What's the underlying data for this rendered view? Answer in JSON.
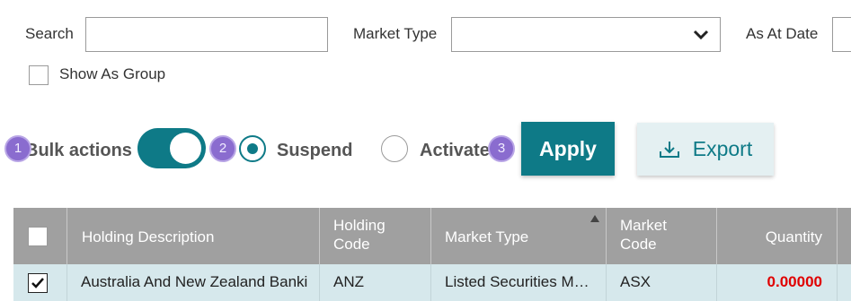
{
  "filters": {
    "search_label": "Search",
    "search_value": "",
    "market_type_label": "Market Type",
    "market_type_value": "",
    "as_at_date_label": "As At Date",
    "show_as_group_label": "Show As Group"
  },
  "bulk": {
    "label": "Bulk actions",
    "suspend_label": "Suspend",
    "activate_label": "Activate",
    "apply_label": "Apply",
    "export_label": "Export",
    "steps": [
      "1",
      "2",
      "3"
    ]
  },
  "table": {
    "columns": [
      "Holding Description",
      "Holding Code",
      "Market Type",
      "Market Code",
      "Quantity"
    ],
    "rows": [
      {
        "holding_description": "Australia And New Zealand Banki",
        "holding_code": "ANZ",
        "market_type": "Listed Securities M…",
        "market_code": "ASX",
        "quantity": "0.00000",
        "checked": true
      }
    ]
  },
  "colors": {
    "accent": "#0e7a87",
    "header_bg": "#a0a0a0",
    "row_bg": "#d6e8ec",
    "negative": "#e00000",
    "badge": "#8a6ccf"
  },
  "icons": [
    "chevron-down-icon",
    "download-icon",
    "checkmark-icon",
    "sort-asc-icon"
  ]
}
